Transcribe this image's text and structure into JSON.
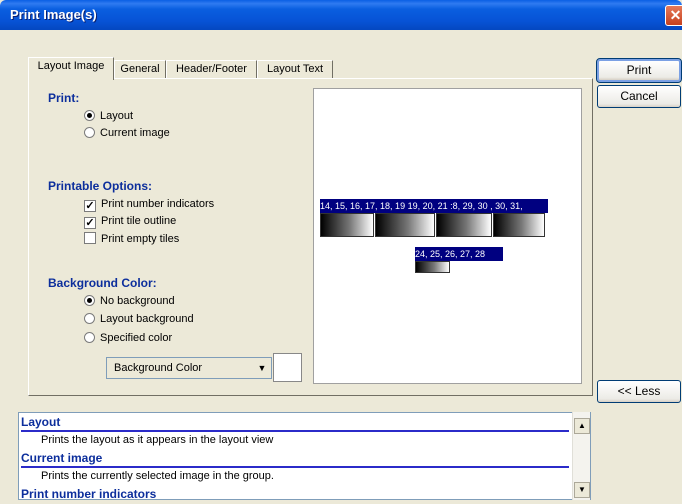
{
  "window": {
    "title": "Print Image(s)",
    "close_glyph": "✕"
  },
  "tabs": [
    {
      "label": "Layout Image",
      "active": true
    },
    {
      "label": "General",
      "active": false
    },
    {
      "label": "Header/Footer",
      "active": false
    },
    {
      "label": "Layout Text",
      "active": false
    }
  ],
  "print_section": {
    "label": "Print:",
    "options": [
      {
        "label": "Layout",
        "selected": true
      },
      {
        "label": "Current image",
        "selected": false
      }
    ]
  },
  "printable_section": {
    "label": "Printable Options:",
    "options": [
      {
        "label": "Print number indicators",
        "checked": true
      },
      {
        "label": "Print tile outline",
        "checked": true
      },
      {
        "label": "Print empty tiles",
        "checked": false
      }
    ]
  },
  "background_section": {
    "label": "Background Color:",
    "options": [
      {
        "label": "No background",
        "selected": true
      },
      {
        "label": "Layout background",
        "selected": false
      },
      {
        "label": "Specified color",
        "selected": false
      }
    ],
    "dropdown_value": "Background Color",
    "swatch_color": "#FFFFFF"
  },
  "preview": {
    "row1_label": "14, 15, 16, 17, 18, 19  19, 20, 21 :8, 29, 30 , 30, 31,",
    "row2_label": "24, 25, 26, 27, 28",
    "tile_label_bg": "#000080"
  },
  "buttons": {
    "print": "Print",
    "cancel": "Cancel",
    "less": "<< Less"
  },
  "help": {
    "entries": [
      {
        "heading": "Layout",
        "text": "Prints the layout as it appears in the layout view"
      },
      {
        "heading": "Current image",
        "text": "Prints the currently selected image in the group."
      },
      {
        "heading": "Print number indicators",
        "text": ""
      }
    ]
  },
  "scrollbar": {
    "up_glyph": "▲",
    "down_glyph": "▼"
  }
}
